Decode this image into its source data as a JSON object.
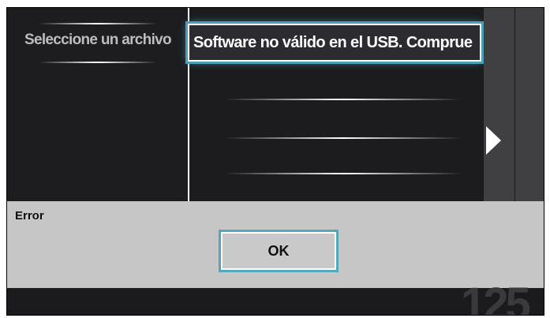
{
  "left_panel": {
    "title": "Seleccione un archivo"
  },
  "file_list": {
    "selected_item": "Software no válido en el USB. Comprue"
  },
  "dialog": {
    "title": "Error",
    "ok_label": "OK"
  },
  "footer": {
    "digits": "125"
  },
  "colors": {
    "accent": "#4a9fb5",
    "screen_bg": "#1d1d1f",
    "dialog_bg": "#c6c6c6"
  },
  "icons": {
    "arrow": "triangle-right-icon"
  }
}
